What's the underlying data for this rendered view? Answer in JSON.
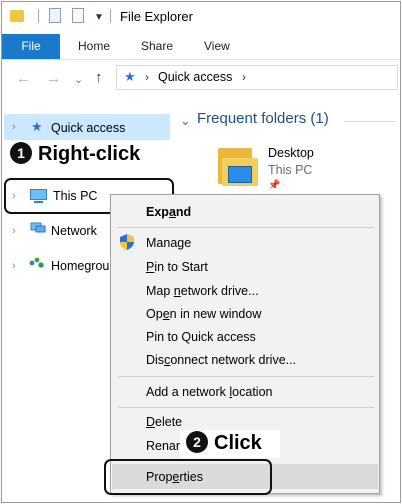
{
  "window": {
    "title": "File Explorer"
  },
  "ribbon": {
    "tabs": [
      "File",
      "Home",
      "Share",
      "View"
    ]
  },
  "address": {
    "path": "Quick access"
  },
  "nav": {
    "items": [
      {
        "label": "Quick access"
      },
      {
        "label": "This PC"
      },
      {
        "label": "Network"
      },
      {
        "label": "Homegrou"
      }
    ]
  },
  "content": {
    "section_title": "Frequent folders (1)",
    "folder": {
      "name": "Desktop",
      "location": "This PC"
    }
  },
  "callouts": {
    "step1_badge": "1",
    "step1_text": "Right-click",
    "step2_badge": "2",
    "step2_text": "Click"
  },
  "menu": {
    "expand": {
      "a": "Exp",
      "u": "a",
      "b": "nd"
    },
    "manage": "Manage",
    "pin_start": {
      "a": "",
      "u": "P",
      "b": "in to Start"
    },
    "map_drive": {
      "a": "Map ",
      "u": "n",
      "b": "etwork drive..."
    },
    "open_window": {
      "a": "Op",
      "u": "e",
      "b": "n in new window"
    },
    "pin_quick": "Pin to Quick access",
    "disconnect": {
      "a": "Dis",
      "u": "c",
      "b": "onnect network drive..."
    },
    "add_location": {
      "a": "Add a network ",
      "u": "l",
      "b": "ocation"
    },
    "delete": {
      "a": "",
      "u": "D",
      "b": "elete"
    },
    "rename": "Renar",
    "properties": {
      "a": "Prop",
      "u": "e",
      "b": "rties"
    }
  },
  "colors": {
    "accent": "#1979ca",
    "selection": "#cce8ff",
    "menu_bg": "#f2f2f2"
  }
}
